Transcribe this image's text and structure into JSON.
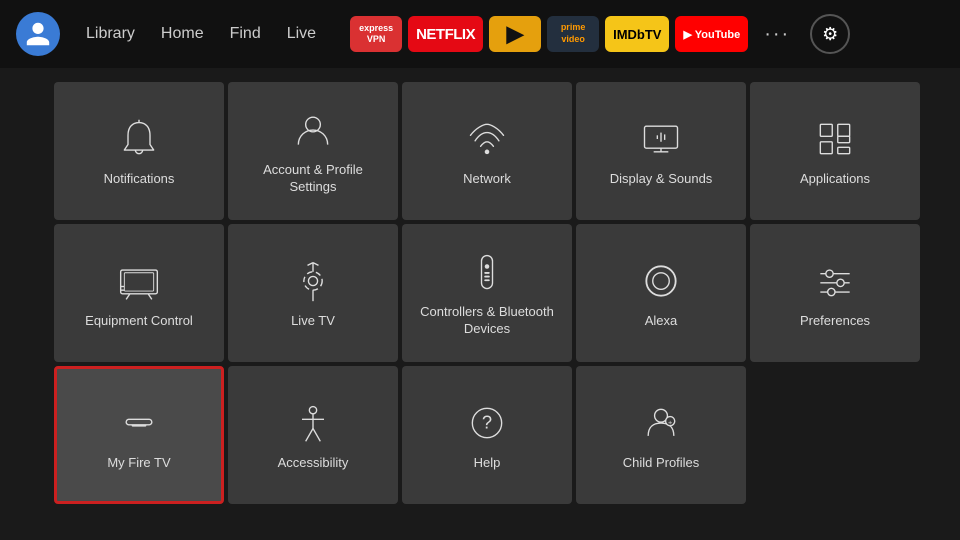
{
  "nav": {
    "links": [
      "Library",
      "Home",
      "Find",
      "Live"
    ],
    "apps": [
      {
        "name": "ExpressVPN",
        "class": "app-expressvpn",
        "label": "express\nVPN"
      },
      {
        "name": "Netflix",
        "class": "app-netflix",
        "label": "NETFLIX"
      },
      {
        "name": "Plex",
        "class": "app-plex",
        "label": "▶"
      },
      {
        "name": "Prime Video",
        "class": "app-prime",
        "label": "prime\nvideo"
      },
      {
        "name": "IMDb TV",
        "class": "app-imdb",
        "label": "IMDbTV"
      },
      {
        "name": "YouTube",
        "class": "app-youtube",
        "label": "▶ YouTube"
      }
    ],
    "more_label": "···",
    "settings_icon": "⚙"
  },
  "tiles": [
    {
      "id": "notifications",
      "label": "Notifications",
      "icon": "bell",
      "selected": false
    },
    {
      "id": "account",
      "label": "Account & Profile Settings",
      "icon": "person",
      "selected": false
    },
    {
      "id": "network",
      "label": "Network",
      "icon": "wifi",
      "selected": false
    },
    {
      "id": "display",
      "label": "Display & Sounds",
      "icon": "display",
      "selected": false
    },
    {
      "id": "applications",
      "label": "Applications",
      "icon": "apps",
      "selected": false
    },
    {
      "id": "equipment",
      "label": "Equipment Control",
      "icon": "tv",
      "selected": false
    },
    {
      "id": "livetv",
      "label": "Live TV",
      "icon": "antenna",
      "selected": false
    },
    {
      "id": "controllers",
      "label": "Controllers & Bluetooth Devices",
      "icon": "remote",
      "selected": false
    },
    {
      "id": "alexa",
      "label": "Alexa",
      "icon": "alexa",
      "selected": false
    },
    {
      "id": "preferences",
      "label": "Preferences",
      "icon": "sliders",
      "selected": false
    },
    {
      "id": "myfiretv",
      "label": "My Fire TV",
      "icon": "firetv",
      "selected": true
    },
    {
      "id": "accessibility",
      "label": "Accessibility",
      "icon": "accessibility",
      "selected": false
    },
    {
      "id": "help",
      "label": "Help",
      "icon": "help",
      "selected": false
    },
    {
      "id": "childprofiles",
      "label": "Child Profiles",
      "icon": "childprofile",
      "selected": false
    }
  ]
}
